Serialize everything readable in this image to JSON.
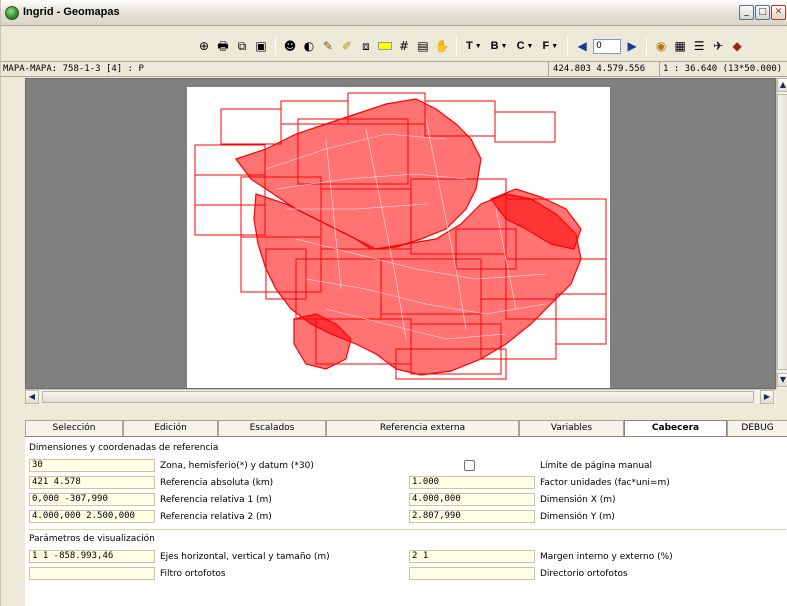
{
  "window": {
    "title": "Ingrid - Geomapas",
    "buttons": [
      "minimize",
      "maximize",
      "close"
    ]
  },
  "toolbar": {
    "icons": [
      "zoom-fit-icon",
      "print-icon",
      "copy-icon",
      "save-icon",
      "palette-icon",
      "contrast-icon",
      "brush-icon",
      "brush-settings-icon",
      "layers-dropdown-icon",
      "color-dropdown-icon",
      "grid-icon",
      "document-icon",
      "hand-icon"
    ],
    "menus": [
      {
        "label": "T"
      },
      {
        "label": "B"
      },
      {
        "label": "C"
      },
      {
        "label": "F"
      }
    ],
    "page_value": "0",
    "right_icons": [
      "globe-icon",
      "table-icon",
      "stack-icon",
      "plane-icon",
      "book-icon"
    ]
  },
  "status": {
    "map_info": "MAPA-MAPA: 758-1-3 [4] : P",
    "coords": "424.803  4.579.556",
    "scale": "1 : 36.640 (13*50.000)"
  },
  "tabs": [
    {
      "label": "Selección",
      "active": false
    },
    {
      "label": "Edición",
      "active": false
    },
    {
      "label": "Escalados",
      "active": false
    },
    {
      "label": "Referencia externa",
      "active": false
    },
    {
      "label": "Variables",
      "active": false
    },
    {
      "label": "Cabecera",
      "active": true
    },
    {
      "label": "DEBUG",
      "active": false
    }
  ],
  "panel": {
    "section1_title": "Dimensiones y coordenadas de referencia",
    "rows1": [
      {
        "value": "30",
        "label": "Zona, hemisferio(*) y datum (*30)",
        "right_label": "Límite de página manual",
        "right_type": "checkbox",
        "right_checked": false
      },
      {
        "value": "421  4.578",
        "label": "Referencia absoluta (km)",
        "right_value": "1.000",
        "right_label": "Factor unidades (fac*uni=m)"
      },
      {
        "value": "0,000  -307,990",
        "label": "Referencia relativa 1 (m)",
        "right_value": "4.000,000",
        "right_label": "Dimensión X (m)"
      },
      {
        "value": "4.000,000  2.500,000",
        "label": "Referencia relativa 2 (m)",
        "right_value": "2.807,990",
        "right_label": "Dimensión Y (m)"
      }
    ],
    "section2_title": "Parámetros de visualización",
    "rows2": [
      {
        "value": "1  1  -858.993,46",
        "label": "Ejes horizontal, vertical y tamaño (m)",
        "right_value": "2  1",
        "right_label": "Margen interno y externo (%)"
      },
      {
        "value": "",
        "label": "Filtro ortofotos",
        "right_value": "",
        "right_label": "Directorio ortofotos"
      }
    ]
  },
  "colors": {
    "map_lines": "#ff0000",
    "field_bg": "#ffffe6",
    "view_bg": "#808080"
  }
}
